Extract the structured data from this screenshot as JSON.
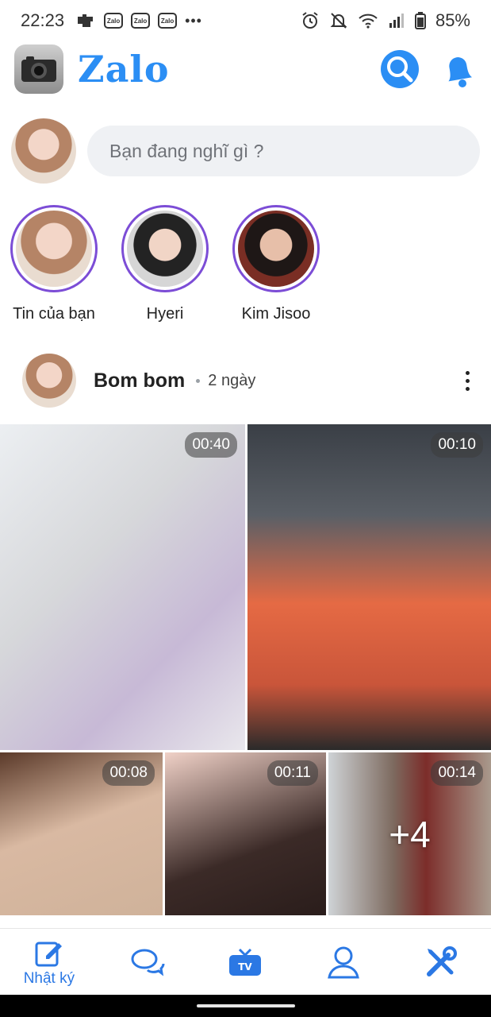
{
  "status_bar": {
    "time": "22:23",
    "notif_label": "Zalo",
    "battery": "85%"
  },
  "header": {
    "brand": "Zalo"
  },
  "composer": {
    "placeholder": "Bạn đang nghĩ gì ?"
  },
  "stories": [
    {
      "label": "Tin của bạn"
    },
    {
      "label": "Hyeri"
    },
    {
      "label": "Kim Jisoo"
    }
  ],
  "post": {
    "author": "Bom bom",
    "time": "2 ngày",
    "media": [
      {
        "duration": "00:40"
      },
      {
        "duration": "00:10"
      },
      {
        "duration": "00:08"
      },
      {
        "duration": "00:11"
      },
      {
        "duration": "00:14",
        "more": "+4"
      }
    ]
  },
  "bottom_nav": {
    "items": [
      {
        "icon": "diary-edit-icon",
        "label": "Nhật ký",
        "active": true
      },
      {
        "icon": "chat-bubbles-icon"
      },
      {
        "icon": "tv-icon"
      },
      {
        "icon": "profile-icon"
      },
      {
        "icon": "tools-icon"
      }
    ]
  },
  "colors": {
    "brand": "#2b8ef4",
    "story_ring": "#7c4dd6",
    "composer_bg": "#eff1f4"
  }
}
